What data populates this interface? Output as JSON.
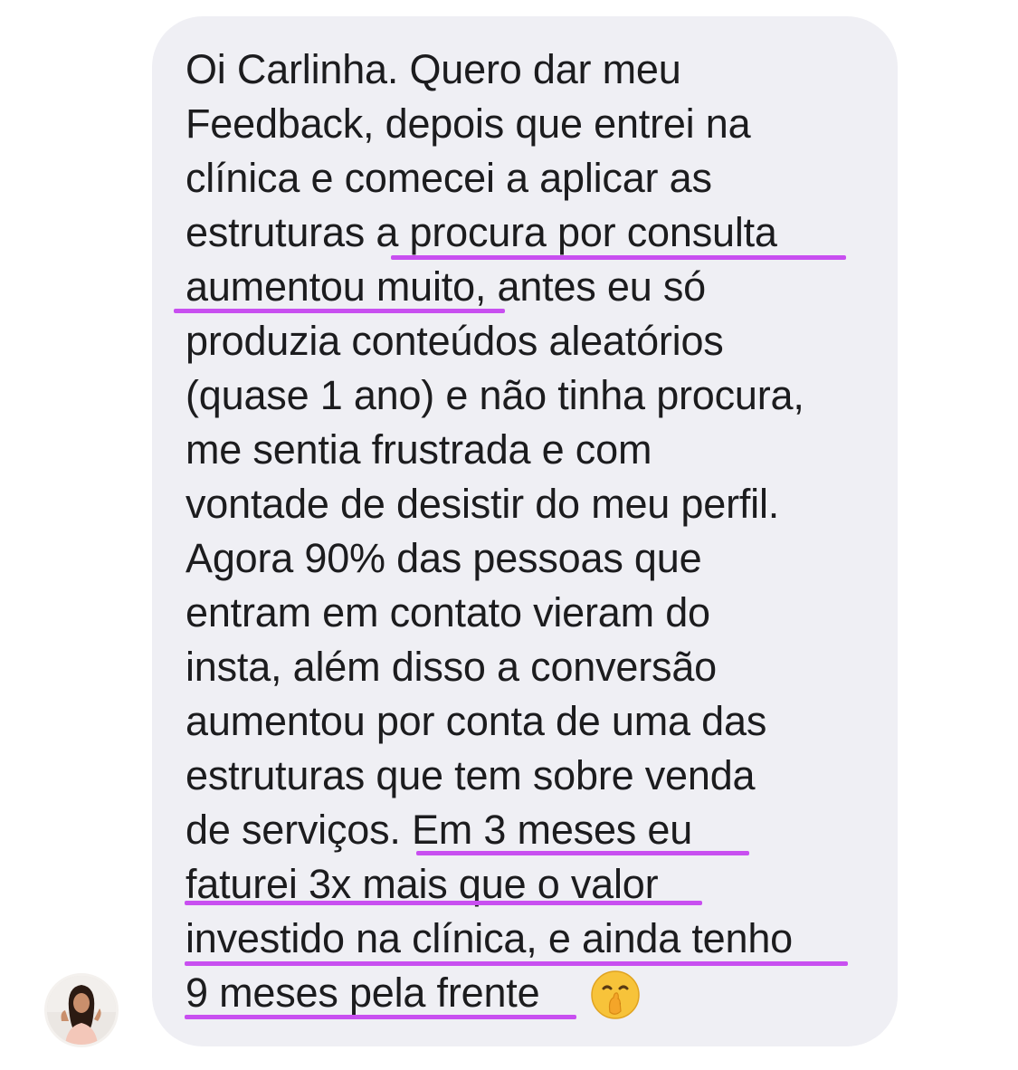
{
  "message": {
    "lines": [
      "Oi Carlinha. Quero dar meu",
      "Feedback, depois que entrei na",
      "clínica e comecei a aplicar as",
      "estruturas a procura por consulta",
      "aumentou muito, antes eu só",
      "produzia conteúdos aleatórios",
      "(quase 1 ano) e não tinha procura,",
      "me sentia frustrada e com",
      "vontade de desistir do meu perfil.",
      "Agora 90% das pessoas que",
      "entram em contato vieram do",
      "insta, além disso a conversão",
      "aumentou por conta de uma das",
      "estruturas que tem sobre venda",
      "de serviços. Em 3 meses eu",
      "faturei 3x mais que o valor",
      "investido na clínica, e ainda tenho",
      "9 meses pela frente"
    ],
    "emoji": "shushing-face-icon",
    "bubble_color": "#efeff4",
    "highlight_color": "#c84ff0",
    "text_color": "#1c1c1e"
  },
  "avatar": {
    "icon": "user-avatar"
  }
}
